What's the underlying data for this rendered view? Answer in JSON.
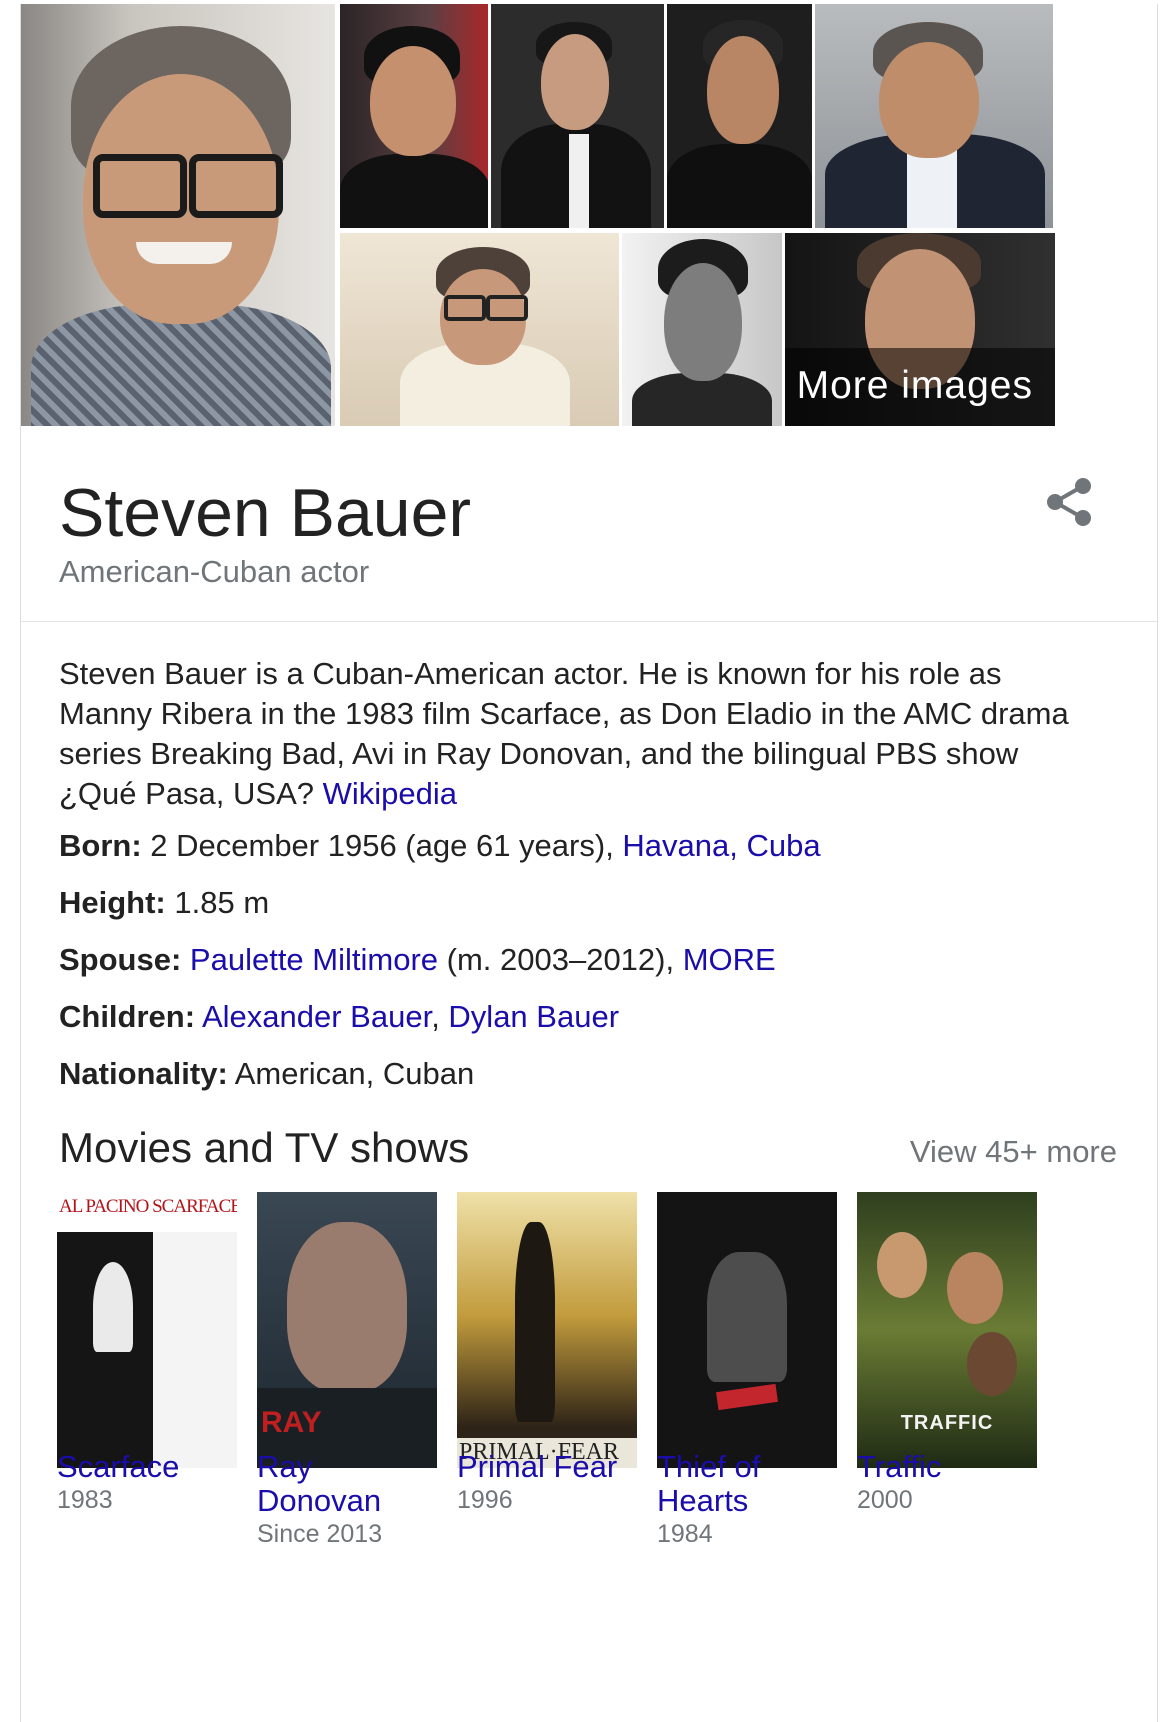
{
  "images": {
    "more_label": "More images"
  },
  "header": {
    "name": "Steven Bauer",
    "subtitle": "American-Cuban actor"
  },
  "description": {
    "text": "Steven Bauer is a Cuban-American actor. He is known for his role as Manny Ribera in the 1983 film Scarface, as Don Eladio in the AMC drama series Breaking Bad, Avi in Ray Donovan, and the bilingual PBS show ¿Qué Pasa, USA? ",
    "source_link": "Wikipedia"
  },
  "facts": {
    "born": {
      "label": "Born:",
      "value": " 2 December 1956 (age 61 years), ",
      "link": "Havana, Cuba"
    },
    "height": {
      "label": "Height:",
      "value": " 1.85 m"
    },
    "spouse": {
      "label": "Spouse:",
      "link": "Paulette Miltimore",
      "value": " (m. 2003–2012), ",
      "more": "MORE"
    },
    "children": {
      "label": "Children:",
      "link1": "Alexander Bauer",
      "sep": ", ",
      "link2": "Dylan Bauer"
    },
    "nationality": {
      "label": "Nationality:",
      "value": " American, Cuban"
    }
  },
  "movies": {
    "section_title": "Movies and TV shows",
    "view_more": "View 45+ more",
    "items": [
      {
        "title_line1": "Scarface",
        "title_line2": "",
        "year": "1983",
        "poster_text": "AL PACINO  SCARFACE"
      },
      {
        "title_line1": "Ray",
        "title_line2": "Donovan",
        "year": "Since 2013",
        "poster_text": "RAY"
      },
      {
        "title_line1": "Primal Fear",
        "title_line2": "",
        "year": "1996",
        "poster_text": "PRIMAL·FEAR"
      },
      {
        "title_line1": "Thief of",
        "title_line2": "Hearts",
        "year": "1984",
        "poster_text": ""
      },
      {
        "title_line1": "Traffic",
        "title_line2": "",
        "year": "2000",
        "poster_text": "TRAFFIC"
      }
    ]
  },
  "colors": {
    "link": "#1a0dab",
    "secondary_text": "#70757a",
    "primary_text": "#222222",
    "divider": "#e3e3e3"
  }
}
